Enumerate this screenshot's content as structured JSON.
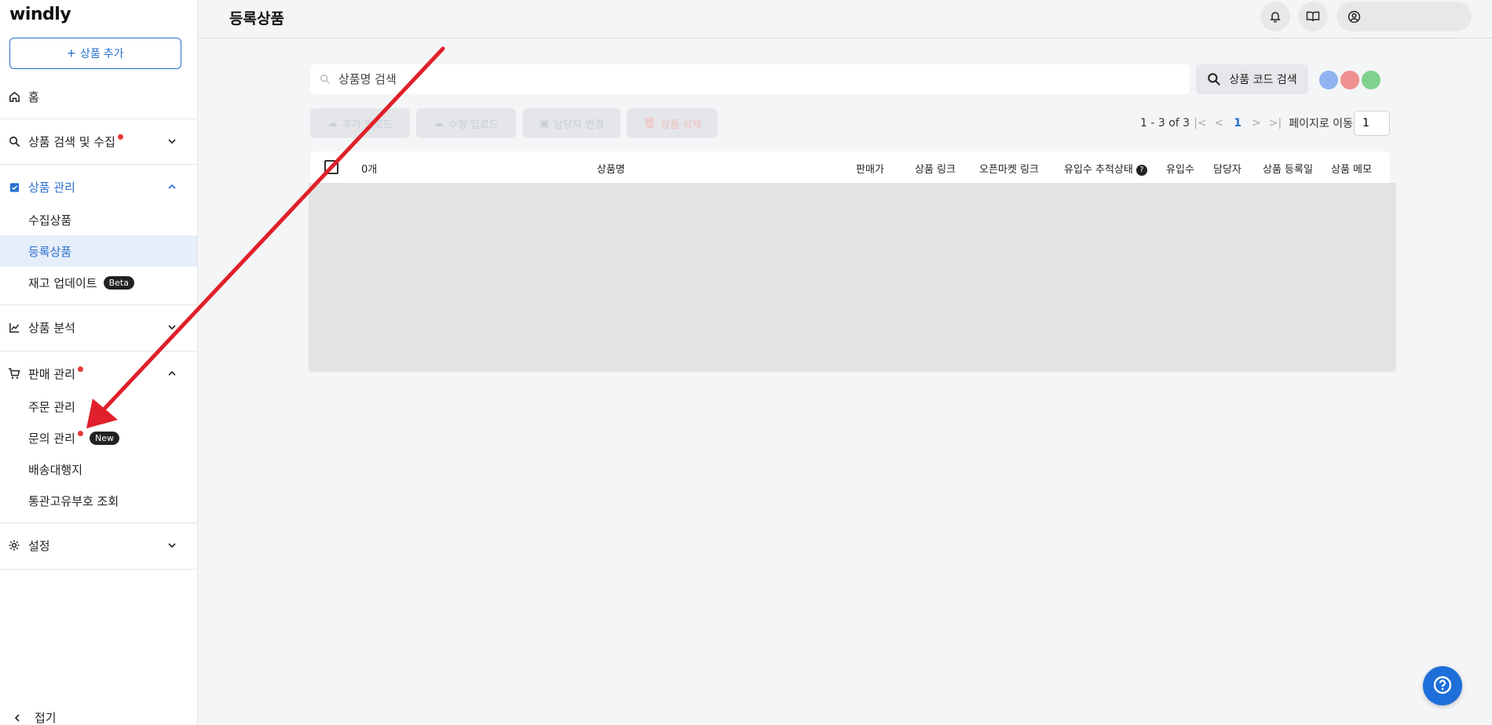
{
  "app": {
    "logo": "windly"
  },
  "sidebar": {
    "add_button": "상품 추가",
    "items": [
      {
        "label": "홈",
        "icon": "home-icon"
      },
      {
        "label": "상품 검색 및 수집",
        "icon": "search-icon",
        "dot": true
      },
      {
        "label": "상품 관리",
        "icon": "clipboard-check-icon",
        "active": true
      },
      {
        "label": "수집상품"
      },
      {
        "label": "등록상품",
        "selected": true
      },
      {
        "label": "재고 업데이트",
        "badge": "Beta"
      },
      {
        "label": "상품 분석",
        "icon": "chart-line-icon"
      },
      {
        "label": "판매 관리",
        "icon": "cart-icon",
        "dot": true
      },
      {
        "label": "주문 관리"
      },
      {
        "label": "문의 관리",
        "badge": "New",
        "dot": true
      },
      {
        "label": "배송대행지"
      },
      {
        "label": "통관고유부호 조회"
      },
      {
        "label": "설정",
        "icon": "gear-icon"
      }
    ],
    "collapse": "접기"
  },
  "header": {
    "title": "등록상품"
  },
  "toolbar": {
    "search_placeholder": "상품명 검색",
    "code_search": "상품 코드 검색",
    "actions": [
      "추가 업로드",
      "수정 업로드",
      "담당자 변경",
      "상품 삭제"
    ],
    "range": "1 - 3 of 3",
    "current_page": "1",
    "goto_label": "페이지로 이동",
    "goto_value": "1"
  },
  "table": {
    "columns": [
      "0개",
      "상품명",
      "판매가",
      "상품 링크",
      "오픈마켓 링크",
      "유입수 추적상태",
      "유입수",
      "담당자",
      "상품 등록일",
      "상품 메모"
    ],
    "help_icon": "?"
  },
  "colors": {
    "accent": "#2a6fcf",
    "notify": "#e53935",
    "arrow": "#e0202a"
  },
  "avatars": [
    {
      "icon": "user-avatar-blue-icon",
      "color": "#8fb4f0"
    },
    {
      "icon": "user-avatar-red-icon",
      "color": "#f08f8f"
    },
    {
      "icon": "user-avatar-green-icon",
      "color": "#7fd18f"
    }
  ]
}
